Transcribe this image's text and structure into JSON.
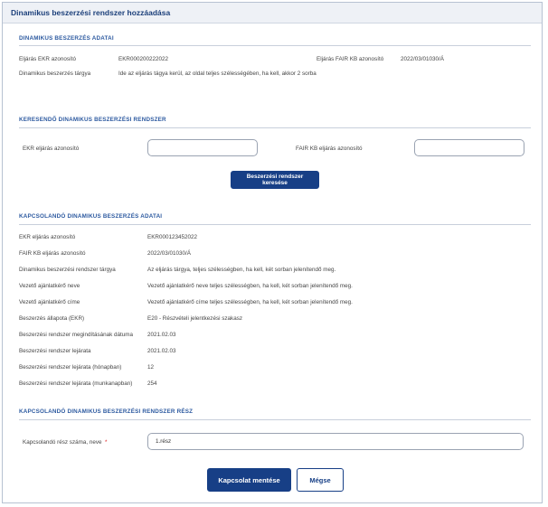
{
  "title": "Dinamikus beszerzési rendszer hozzáadása",
  "sections": {
    "adatai": {
      "heading": "DINAMIKUS BESZERZÉS ADATAI",
      "ekr_label": "Eljárás EKR azonosító",
      "ekr_value": "EKR000200222022",
      "fair_label": "Eljárás FAIR KB azonosító",
      "fair_value": "2022/03/01030/Á",
      "targy_label": "Dinamikus beszerzés tárgya",
      "targy_value": "Ide az eljárás tágya kerül, az oldal teljes szélességében, ha kell, akkor 2 sorba"
    },
    "kereso": {
      "heading": "KERESENDŐ DINAMIKUS BESZERZÉSI RENDSZER",
      "ekr_label": "EKR eljárás azonosító",
      "ekr_value": "",
      "fair_label": "FAIR KB  eljárás azonosító",
      "fair_value": "",
      "search_button": "Beszerzési rendszer keresése"
    },
    "kapcsolando": {
      "heading": "KAPCSOLANDÓ DINAMIKUS BESZERZÉS ADATAI",
      "rows": [
        {
          "label": "EKR eljárás azonosító",
          "value": "EKR000123452022"
        },
        {
          "label": "FAIR KB  eljárás azonosító",
          "value": "2022/03/01030/Á"
        },
        {
          "label": "Dinamikus beszerzési rendszer  tárgya",
          "value": "Az eljárás tárgya, teljes szélességben, ha kell, két sorban jelenítendő meg."
        },
        {
          "label": "Vezető ajánlatkérő neve",
          "value": "Vezető ajánlatkérő neve teljes szélességben, ha kell, két sorban jelenítendő meg."
        },
        {
          "label": "Vezető ajánlatkérő címe",
          "value": "Vezető ajánlatkérő címe teljes szélességben, ha kell, két sorban jelenítendő meg."
        },
        {
          "label": "Beszerzés állapota (EKR)",
          "value": "E20 - Részvételi jelentkezési szakasz"
        },
        {
          "label": "Beszerzési rendszer megindításának dátuma",
          "value": "2021.02.03"
        },
        {
          "label": "Beszerzési rendszer lejárata",
          "value": "2021.02.03"
        },
        {
          "label": "Beszerzési rendszer lejárata (hónapban)",
          "value": "12"
        },
        {
          "label": "Beszerzési rendszer lejárata (munkanapban)",
          "value": "254"
        }
      ]
    },
    "resz": {
      "heading": "KAPCSOLANDÓ DINAMIKUS BESZERZÉSI RENDSZER RÉSZ",
      "label": "Kapcsolandó rész száma, neve",
      "required_mark": "*",
      "value": "1.rész"
    }
  },
  "buttons": {
    "save": "Kapcsolat mentése",
    "cancel": "Mégse"
  },
  "colors": {
    "primary": "#173f86",
    "section_heading": "#2d5aa0",
    "required": "#dd2222"
  }
}
